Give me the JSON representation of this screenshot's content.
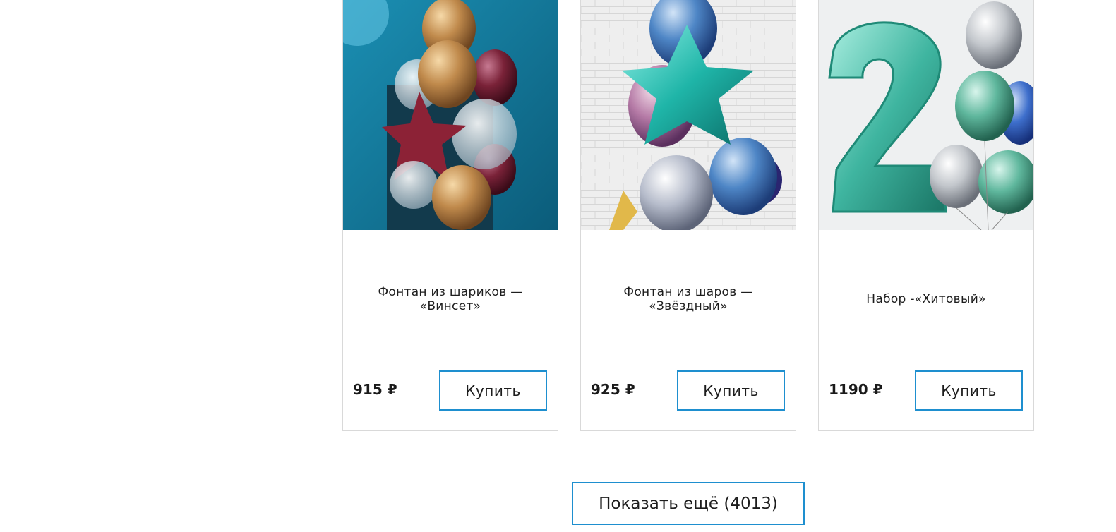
{
  "products": [
    {
      "title": "Фонтан из шариков — «Винсет»",
      "price": "915 ₽",
      "buy_label": "Купить",
      "image": "balloon-fountain-vinset"
    },
    {
      "title": "Фонтан из шаров — «Звёздный»",
      "price": "925 ₽",
      "buy_label": "Купить",
      "image": "balloon-fountain-star"
    },
    {
      "title": "Набор -«Хитовый»",
      "price": "1190 ₽",
      "buy_label": "Купить",
      "image": "balloon-set-number-2"
    }
  ],
  "show_more_label": "Показать ещё (4013)",
  "colors": {
    "accent": "#1e8fcf",
    "border": "#d9d9d9"
  }
}
